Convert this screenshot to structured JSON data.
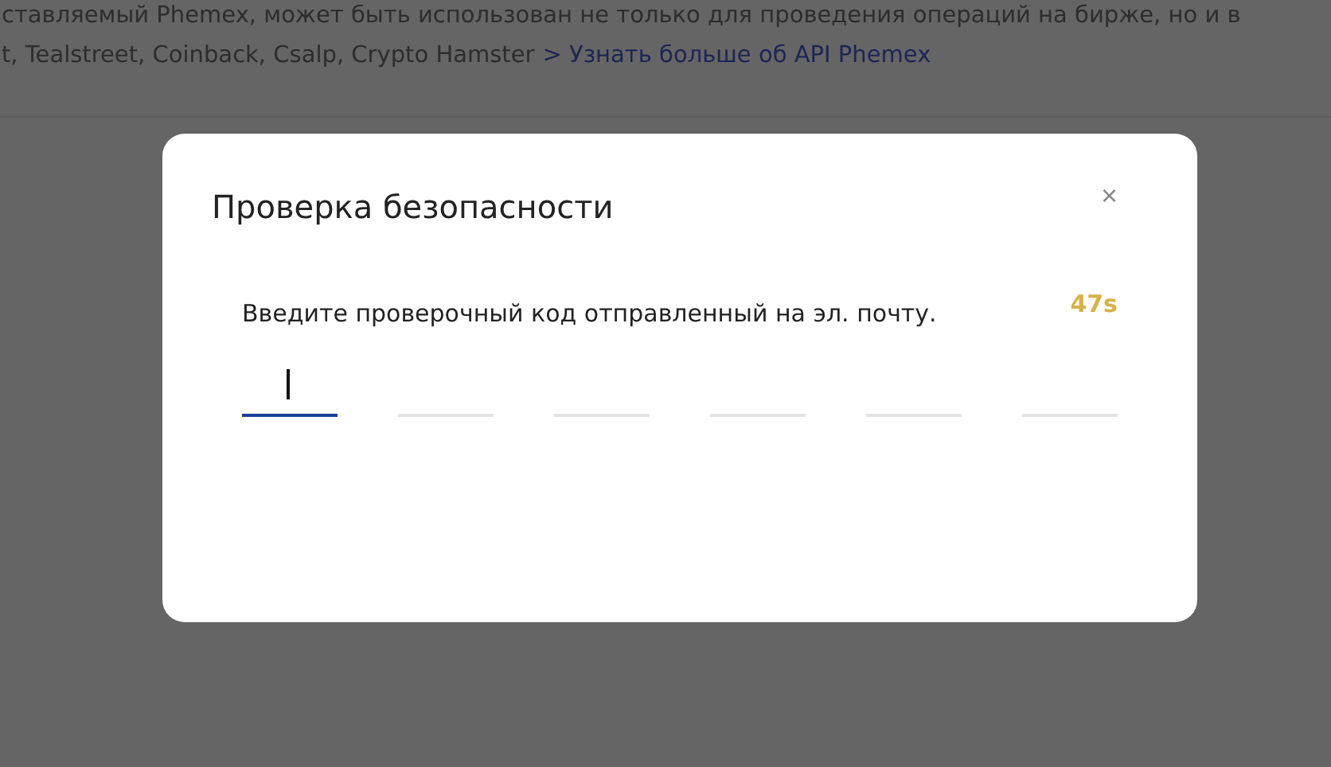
{
  "background": {
    "description": "ставляемый Phemex, может быть использован не только для проведения операций на бирже, но и в",
    "partners": "t, Tealstreet, Coinback, Csalp, Crypto Hamster",
    "link": "> Узнать больше об API Phemex"
  },
  "dialog": {
    "title": "Проверка безопасности",
    "close": "×",
    "prompt": "Введите проверочный код отправленный на эл. почту.",
    "countdown": "47s",
    "code_slots": [
      {
        "selected": true
      },
      {
        "selected": false
      },
      {
        "selected": false
      },
      {
        "selected": false
      },
      {
        "selected": false
      },
      {
        "selected": false
      }
    ]
  }
}
